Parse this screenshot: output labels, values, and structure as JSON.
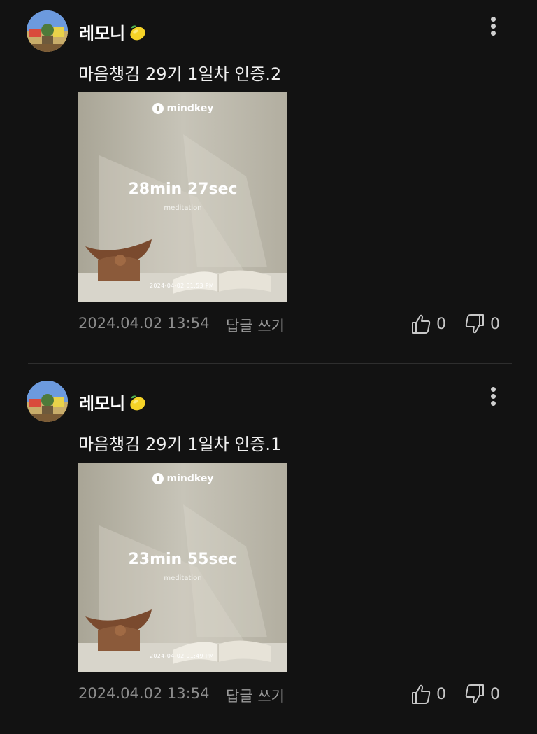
{
  "comments": [
    {
      "author": "레모니",
      "author_emoji": "lemon-icon",
      "text": "마음챙김 29기 1일차 인증.2",
      "image": {
        "brand": "mindkey",
        "duration": "28min 27sec",
        "label": "meditation",
        "timestamp": "2024-04-02 01:53 PM"
      },
      "date": "2024.04.02 13:54",
      "reply_label": "답글 쓰기",
      "likes": "0",
      "dislikes": "0"
    },
    {
      "author": "레모니",
      "author_emoji": "lemon-icon",
      "text": "마음챙김 29기 1일차 인증.1",
      "image": {
        "brand": "mindkey",
        "duration": "23min 55sec",
        "label": "meditation",
        "timestamp": "2024-04-02 01:49 PM"
      },
      "date": "2024.04.02 13:54",
      "reply_label": "답글 쓰기",
      "likes": "0",
      "dislikes": "0"
    }
  ],
  "colors": {
    "background": "#121212",
    "text_primary": "#f2f2f2",
    "text_muted": "#8c8c8c",
    "photo_bg": "#b9b5a7"
  }
}
